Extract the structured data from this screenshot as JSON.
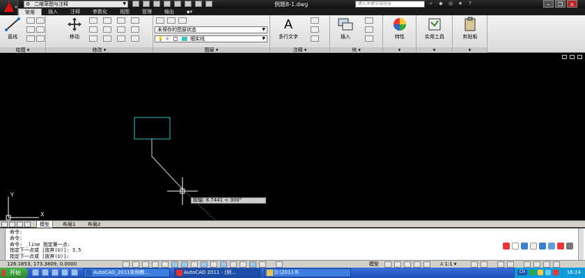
{
  "title_bar": {
    "workspace": "二维草图与注释",
    "document_title": "例题8-1.dwg",
    "search_placeholder": "键入关键字或短语"
  },
  "tabs": [
    "常用",
    "插入",
    "注释",
    "参数化",
    "视图",
    "管理",
    "输出"
  ],
  "ribbon": {
    "line_label": "直线",
    "move_label": "移动",
    "draw_panel": "绘图",
    "modify_panel": "修改",
    "layer_state": "未保存的图层状态",
    "linetype": "细实线",
    "layer_panel": "图层",
    "mtext_label": "多行文字",
    "annotation_panel": "注释",
    "insert_label": "插入",
    "block_panel": "块",
    "properties_label": "特性",
    "utilities_label": "实用工具",
    "clipboard_label": "剪贴板"
  },
  "canvas": {
    "ucs_y": "Y",
    "ucs_x": "X",
    "dynamic_input": "极轴: 8.7441 < 300°"
  },
  "layout_tabs": [
    "模型",
    "布局1",
    "布局2"
  ],
  "command_history": [
    "命令:",
    "命令:",
    "命令: _line 指定第一点:",
    "指定下一点或 [放弃(U)]: 3.5",
    "指定下一点或 [放弃(U)]:"
  ],
  "status_bar": {
    "coordinates": "126.1853, 173.3809, 0.0000",
    "model": "模型",
    "scale": "1:1"
  },
  "taskbar": {
    "start": "开始",
    "tasks": [
      "AutoCAD_2011实例教...",
      "AutoCAD 2011 - [例...",
      "D:\\2011书"
    ],
    "lang": "CH",
    "clock": "16:24"
  },
  "colors": {
    "rectangle": "#33c4c4",
    "line": "#d8d8d8",
    "tracking": "#2e9e2e",
    "ribbon": "#e4e4e4",
    "canvas": "#000000"
  }
}
